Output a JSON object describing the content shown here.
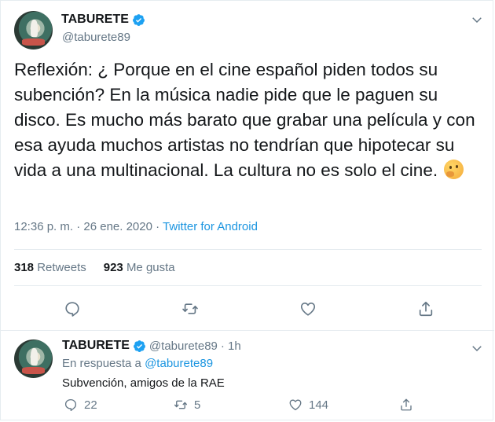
{
  "tweet": {
    "author": {
      "name": "TABURETE",
      "handle": "@taburete89"
    },
    "text": "Reflexión: ¿ Porque en el cine español piden todos su subención? En la música nadie pide que le paguen su disco. Es mucho más barato que grabar una película y con esa ayuda muchos artistas no tendrían que hipotecar su vida a una multinacional. La cultura no es solo el cine.",
    "emoji": "thinking-face",
    "timestamp": "12:36 p. m. · 26 ene. 2020 · ",
    "source": "Twitter for Android",
    "stats": {
      "retweets_count": "318",
      "retweets_label": "Retweets",
      "likes_count": "923",
      "likes_label": "Me gusta"
    },
    "actions": [
      "reply-icon",
      "retweet-icon",
      "like-icon",
      "share-icon"
    ]
  },
  "reply": {
    "author": {
      "name": "TABURETE",
      "handle": "@taburete89"
    },
    "time": "· 1h",
    "in_reply_prefix": "En respuesta a ",
    "in_reply_to": "@taburete89",
    "text": "Subvención, amigos de la RAE",
    "reply_count": "22",
    "retweet_count": "5",
    "like_count": "144"
  },
  "colors": {
    "accent": "#1b95e0",
    "verified": "#1da1f2",
    "muted": "#657786",
    "text": "#14171a"
  }
}
